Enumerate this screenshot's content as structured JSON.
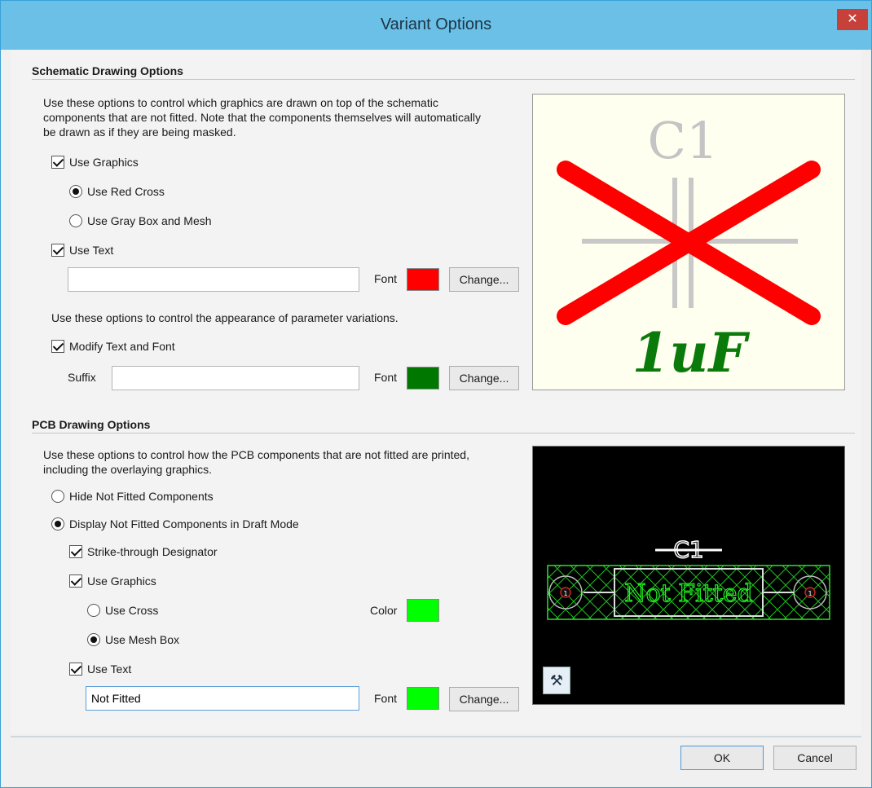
{
  "window": {
    "title": "Variant Options",
    "close_glyph": "✕"
  },
  "schematic": {
    "section_title": "Schematic Drawing Options",
    "description": "Use these options to control which graphics are drawn on top of the schematic components that are not fitted. Note that the components themselves will automatically be drawn as if they are being masked.",
    "use_graphics": {
      "label": "Use Graphics",
      "checked": true
    },
    "use_red_cross": {
      "label": "Use Red Cross",
      "checked": true
    },
    "use_gray_box": {
      "label": "Use Gray Box and Mesh",
      "checked": false
    },
    "use_text": {
      "label": "Use Text",
      "checked": true
    },
    "text_value": "",
    "font_label": "Font",
    "font_color": "#ff0000",
    "change_label": "Change...",
    "param_description": "Use these options to control the appearance of parameter variations.",
    "modify_text": {
      "label": "Modify Text and Font",
      "checked": true
    },
    "suffix_label": "Suffix",
    "suffix_value": "",
    "font2_label": "Font",
    "font2_color": "#007800",
    "change2_label": "Change...",
    "preview": {
      "designator": "C1",
      "value": "1uF",
      "cross_color": "#ff0000",
      "value_color": "#0a7a0a",
      "designator_color": "#c4c4c4"
    }
  },
  "pcb": {
    "section_title": "PCB Drawing Options",
    "description": "Use these options to control how the PCB components that are not fitted are printed, including the overlaying graphics.",
    "hide_not_fitted": {
      "label": "Hide Not Fitted Components",
      "checked": false
    },
    "display_draft": {
      "label": "Display Not Fitted Components in Draft Mode",
      "checked": true
    },
    "strike_designator": {
      "label": "Strike-through Designator",
      "checked": true
    },
    "use_graphics": {
      "label": "Use Graphics",
      "checked": true
    },
    "use_cross": {
      "label": "Use Cross",
      "checked": false
    },
    "use_mesh_box": {
      "label": "Use Mesh Box",
      "checked": true
    },
    "color_label": "Color",
    "color_value": "#00ff00",
    "use_text": {
      "label": "Use Text",
      "checked": true
    },
    "text_value": "Not Fitted",
    "font_label": "Font",
    "font_color": "#00ff00",
    "change_label": "Change...",
    "preview": {
      "designator": "C1",
      "text": "Not Fitted",
      "pad_label": "1",
      "tool_icon": "hammer-wrench-icon"
    }
  },
  "buttons": {
    "ok": "OK",
    "cancel": "Cancel"
  }
}
